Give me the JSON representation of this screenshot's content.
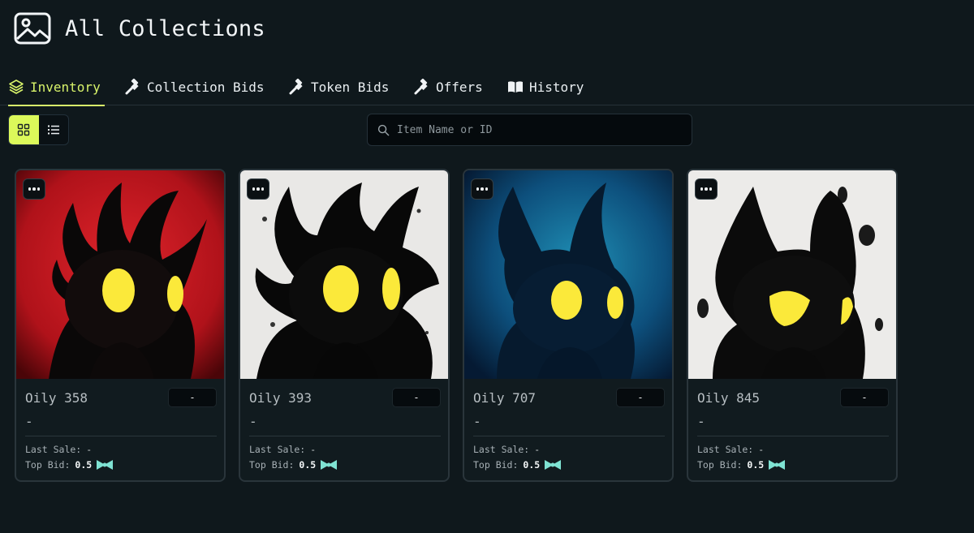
{
  "header": {
    "title": "All Collections",
    "icon": "image-icon"
  },
  "tabs": [
    {
      "label": "Inventory",
      "icon": "layers-icon",
      "active": true
    },
    {
      "label": "Collection Bids",
      "icon": "gavel-icon",
      "active": false
    },
    {
      "label": "Token Bids",
      "icon": "gavel-icon",
      "active": false
    },
    {
      "label": "Offers",
      "icon": "gavel-icon",
      "active": false
    },
    {
      "label": "History",
      "icon": "book-icon",
      "active": false
    }
  ],
  "view_toggle": {
    "options": [
      "grid-view",
      "list-view"
    ],
    "selected": "grid-view"
  },
  "search": {
    "placeholder": "Item Name or ID",
    "value": ""
  },
  "colors": {
    "accent": "#dcf95a",
    "background": "#0f181c",
    "card": "#111b1f",
    "token": "#7fe3d3"
  },
  "cards": [
    {
      "name": "Oily 358",
      "price_label": "-",
      "subtitle": "-",
      "last_sale_label": "Last Sale:",
      "last_sale": "-",
      "top_bid_label": "Top Bid:",
      "top_bid": "0.5",
      "currency_icon": "bowtie-token-icon"
    },
    {
      "name": "Oily 393",
      "price_label": "-",
      "subtitle": "-",
      "last_sale_label": "Last Sale:",
      "last_sale": "-",
      "top_bid_label": "Top Bid:",
      "top_bid": "0.5",
      "currency_icon": "bowtie-token-icon"
    },
    {
      "name": "Oily 707",
      "price_label": "-",
      "subtitle": "-",
      "last_sale_label": "Last Sale:",
      "last_sale": "-",
      "top_bid_label": "Top Bid:",
      "top_bid": "0.5",
      "currency_icon": "bowtie-token-icon"
    },
    {
      "name": "Oily 845",
      "price_label": "-",
      "subtitle": "-",
      "last_sale_label": "Last Sale:",
      "last_sale": "-",
      "top_bid_label": "Top Bid:",
      "top_bid": "0.5",
      "currency_icon": "bowtie-token-icon"
    }
  ]
}
